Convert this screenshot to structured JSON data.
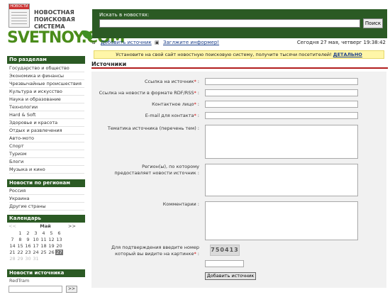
{
  "logo": {
    "top_text": "НОВОСТИ",
    "tagline": "НОВОСТНАЯ ПОИСКОВАЯ СИСТЕМА",
    "wordmark": "SVETNOY.COM"
  },
  "search": {
    "label": "Искать в новостях:",
    "value": "",
    "button": "Поиск"
  },
  "toplinks": {
    "add_source": "Добавить источник",
    "informer": "Заглжите информер!",
    "date": "Сегодня 27 мая, четверг 19:38:42"
  },
  "banner": {
    "text": "Установите на свой сайт новостную поисковую систему, получите тысячи посетителей!",
    "link": "ДЕТАЛЬНО"
  },
  "page_title": "Источники",
  "sidebar": {
    "sections_title": "По разделам",
    "sections": [
      "Государство и общество",
      "Экономика и финансы",
      "Чрезвычайные происшествия",
      "Культура и искусство",
      "Наука и образование",
      "Технологии",
      "Hard & Soft",
      "Здоровье и красота",
      "Отдых и развлечения",
      "Авто-мото",
      "Спорт",
      "Туризм",
      "Блоги",
      "Музыка и кино"
    ],
    "regions_title": "Новости по регионам",
    "regions": [
      "Россия",
      "Украина",
      "Другие страны"
    ],
    "calendar_title": "Календарь",
    "calendar": {
      "prev": "<<",
      "month": "Май",
      "next": ">>",
      "weeks": [
        [
          "",
          "1",
          "2",
          "3",
          "4",
          "5",
          "6"
        ],
        [
          "7",
          "8",
          "9",
          "10",
          "11",
          "12",
          "13"
        ],
        [
          "14",
          "15",
          "16",
          "17",
          "18",
          "19",
          "20"
        ],
        [
          "21",
          "22",
          "23",
          "24",
          "25",
          "26",
          "27"
        ],
        [
          "28",
          "29",
          "30",
          "31",
          "",
          "",
          ""
        ]
      ],
      "today": "27"
    },
    "source_title": "Новости источника",
    "source_label": "RedTram",
    "source_button": ">>"
  },
  "form": {
    "fields": [
      {
        "label": "Ссылка на источник",
        "required": "*"
      },
      {
        "label": "Ссылка на новости в формате RDF/RSS",
        "required": "*"
      },
      {
        "label": "Контактное лицо",
        "required": "*"
      },
      {
        "label": "E-mail для контакта",
        "required": "*"
      }
    ],
    "topics_label": "Тематика источника (перечень тем) :",
    "regions_label": "Регион(ы), по которому предоставляет новости источник :",
    "comments_label": "Комментарии :",
    "captcha_label": "Для подтверждения введите номер который вы видите на картинке",
    "captcha_required": "*",
    "captcha_value": "750413",
    "submit": "Добавить источник"
  }
}
